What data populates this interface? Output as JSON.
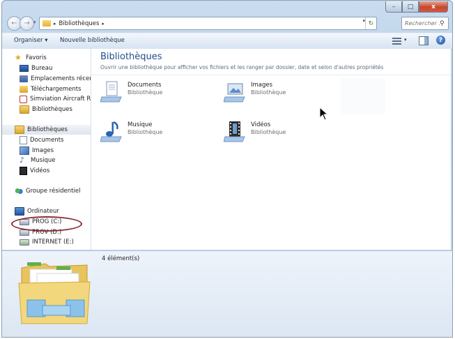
{
  "window": {
    "caption_buttons": {
      "minimize": "–",
      "maximize": "□",
      "close": "x"
    }
  },
  "address_bar": {
    "back_glyph": "←",
    "forward_glyph": "→",
    "crumb": "Bibliothèques",
    "crumb_separator": "▸",
    "refresh_glyph": "↻",
    "search_placeholder": "Rechercher ...",
    "search_icon": "search-icon"
  },
  "toolbar": {
    "organize": "Organiser ▾",
    "new_library": "Nouvelle bibliothèque",
    "help": "?"
  },
  "nav_pane": {
    "favorites": {
      "label": "Favoris",
      "items": [
        "Bureau",
        "Emplacements récents",
        "Téléchargements",
        "Simviation Aircraft Repa",
        "Bibliothèques"
      ]
    },
    "libraries": {
      "label": "Bibliothèques",
      "items": [
        "Documents",
        "Images",
        "Musique",
        "Vidéos"
      ]
    },
    "homegroup": {
      "label": "Groupe résidentiel"
    },
    "computer": {
      "label": "Ordinateur",
      "drives": [
        "PROG (C:)",
        "PROV (D:)",
        "INTERNET (E:)"
      ]
    }
  },
  "content": {
    "title": "Bibliothèques",
    "subtitle": "Ouvrir une bibliothèque pour afficher vos fichiers et les ranger par dossier, date et selon d'autres propriétés",
    "libraries": [
      {
        "name": "Documents",
        "type": "Bibliothèque",
        "icon": "documents-library-icon"
      },
      {
        "name": "Images",
        "type": "Bibliothèque",
        "icon": "pictures-library-icon"
      },
      {
        "name": "Musique",
        "type": "Bibliothèque",
        "icon": "music-library-icon"
      },
      {
        "name": "Vidéos",
        "type": "Bibliothèque",
        "icon": "videos-library-icon"
      }
    ]
  },
  "details": {
    "count": "4 élément(s)"
  },
  "colors": {
    "title_blue": "#1e4e8c",
    "annotation_ellipse": "#8b2a2a",
    "close_red": "#c7472e"
  }
}
